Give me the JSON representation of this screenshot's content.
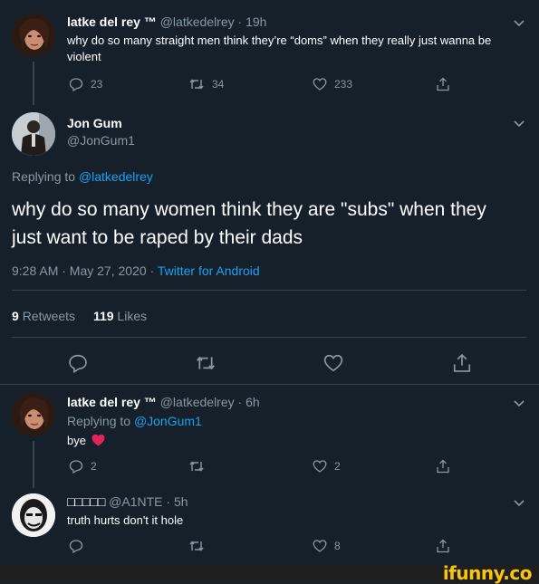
{
  "tweet1": {
    "name": "latke del rey ™",
    "handle_time": "@latkedelrey · 19h",
    "text": "why do so many straight men think they’re “doms” when they really just wanna be violent",
    "replies": "23",
    "retweets": "34",
    "likes": "233"
  },
  "main": {
    "name": "Jon Gum",
    "handle": "@JonGum1",
    "replying_prefix": "Replying to",
    "replying_to": "@latkedelrey",
    "text": "why do so many women think they are \"subs\" when they just want to be raped by their dads",
    "timestamp": "9:28 AM · May 27, 2020 ·",
    "source": "Twitter for Android",
    "retweet_count": "9",
    "retweet_label": "Retweets",
    "like_count": "119",
    "like_label": "Likes"
  },
  "reply1": {
    "name": "latke del rey ™",
    "handle_time": "@latkedelrey · 6h",
    "replying_prefix": "Replying to",
    "replying_to": "@JonGum1",
    "text": "bye",
    "replies": "2",
    "likes": "2"
  },
  "reply2": {
    "name": "□□□□□",
    "handle_time": "@A1NTE · 5h",
    "text": "truth hurts don't it hole",
    "likes": "8"
  },
  "watermark": "ifunny.co",
  "colors": {
    "background": "#15202b",
    "muted": "#8899a6",
    "link": "#1da1f2",
    "heart": "#e0245e",
    "watermark": "#f9c60a"
  }
}
